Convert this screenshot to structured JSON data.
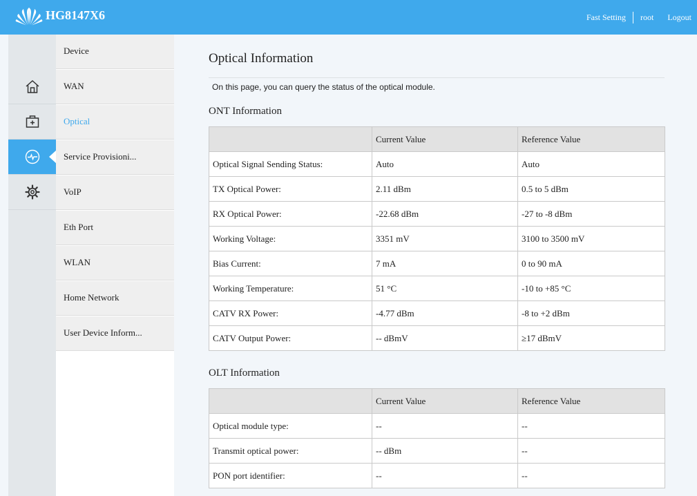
{
  "header": {
    "model": "HG8147X6",
    "fast_setting": "Fast Setting",
    "user": "root",
    "logout": "Logout",
    "brand_color": "#3fa9ec"
  },
  "rail": {
    "items": [
      {
        "icon": "home-icon"
      },
      {
        "icon": "toolbox-icon"
      },
      {
        "icon": "diagnose-pulse-icon",
        "active": true
      },
      {
        "icon": "gear-icon"
      }
    ]
  },
  "submenu": {
    "items": [
      {
        "label": "Device"
      },
      {
        "label": "WAN"
      },
      {
        "label": "Optical",
        "active": true
      },
      {
        "label": "Service Provisioni..."
      },
      {
        "label": "VoIP"
      },
      {
        "label": "Eth Port"
      },
      {
        "label": "WLAN"
      },
      {
        "label": "Home Network"
      },
      {
        "label": "User Device Inform..."
      }
    ]
  },
  "main": {
    "title": "Optical Information",
    "description": "On this page, you can query the status of the optical module.",
    "ont": {
      "title": "ONT Information",
      "headers": [
        "",
        "Current Value",
        "Reference Value"
      ],
      "rows": [
        [
          "Optical Signal Sending Status:",
          "Auto",
          "Auto"
        ],
        [
          "TX Optical Power:",
          "2.11 dBm",
          "0.5 to 5 dBm"
        ],
        [
          "RX Optical Power:",
          "-22.68 dBm",
          "-27 to -8 dBm"
        ],
        [
          "Working Voltage:",
          "3351 mV",
          "3100 to 3500 mV"
        ],
        [
          "Bias Current:",
          "7 mA",
          "0 to 90 mA"
        ],
        [
          "Working Temperature:",
          "51 °C",
          "-10 to +85 °C"
        ],
        [
          "CATV RX Power:",
          "-4.77 dBm",
          "-8 to +2 dBm"
        ],
        [
          "CATV Output Power:",
          "-- dBmV",
          "≥17 dBmV"
        ]
      ]
    },
    "olt": {
      "title": "OLT Information",
      "headers": [
        "",
        "Current Value",
        "Reference Value"
      ],
      "rows": [
        [
          "Optical module type:",
          "--",
          "--"
        ],
        [
          "Transmit optical power:",
          "-- dBm",
          "--"
        ],
        [
          "PON port identifier:",
          "--",
          "--"
        ]
      ]
    }
  }
}
